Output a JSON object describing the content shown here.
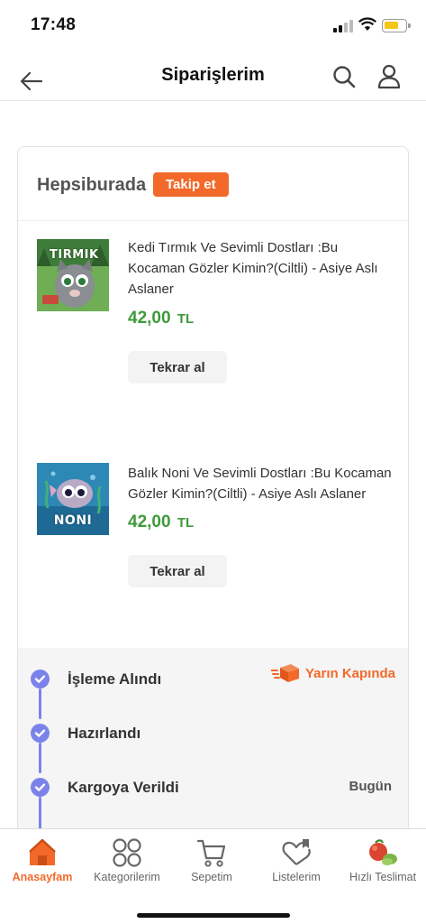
{
  "status_bar": {
    "time": "17:48"
  },
  "header": {
    "title": "Siparişlerim"
  },
  "seller": {
    "name": "Hepsiburada",
    "follow_label": "Takip et"
  },
  "products": [
    {
      "title": "Kedi Tırmık Ve Sevimli Dostları :Bu Kocaman Gözler Kimin?(Ciltli) - Asiye Aslı Aslaner",
      "price": "42,00",
      "currency": "TL",
      "reorder_label": "Tekrar al",
      "cover_text": "TIRMIK"
    },
    {
      "title": "Balık Noni Ve Sevimli Dostları :Bu Kocaman Gözler Kimin?(Ciltli) - Asiye Aslı Aslaner",
      "price": "42,00",
      "currency": "TL",
      "reorder_label": "Tekrar al",
      "cover_text": "NONI"
    }
  ],
  "delivery_tag": "Yarın Kapında",
  "tracking_steps": [
    {
      "label": "İşleme Alındı",
      "right": ""
    },
    {
      "label": "Hazırlandı",
      "right": ""
    },
    {
      "label": "Kargoya Verildi",
      "right": "Bugün"
    }
  ],
  "bottom_nav": [
    {
      "label": "Anasayfam",
      "icon": "home-icon",
      "active": true
    },
    {
      "label": "Kategorilerim",
      "icon": "categories-icon",
      "active": false
    },
    {
      "label": "Sepetim",
      "icon": "cart-icon",
      "active": false
    },
    {
      "label": "Listelerim",
      "icon": "heart-list-icon",
      "active": false
    },
    {
      "label": "Hızlı Teslimat",
      "icon": "fast-delivery-icon",
      "active": false
    }
  ],
  "colors": {
    "accent": "#f2692a",
    "price": "#3e9a3a",
    "tracking": "#7b83eb"
  }
}
